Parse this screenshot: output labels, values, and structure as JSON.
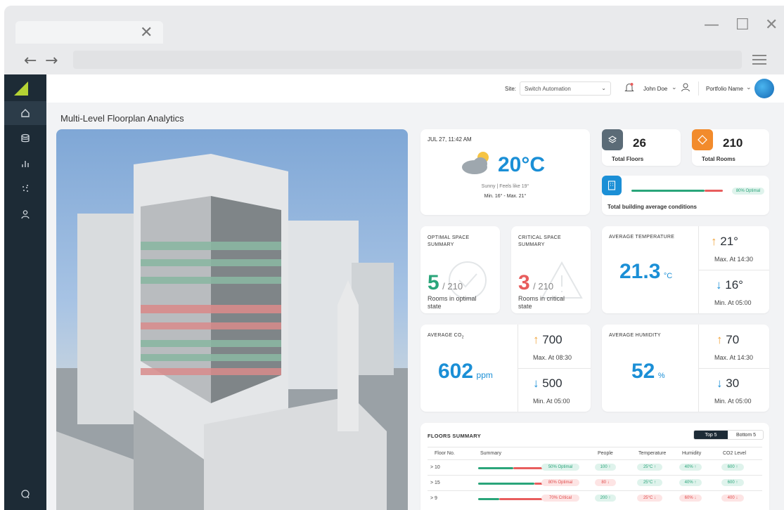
{
  "browser": {
    "close_glyph": "✕",
    "minimize_glyph": "—",
    "maximize_glyph": "☐",
    "window_close_glyph": "✕",
    "back_glyph": "←",
    "forward_glyph": "→"
  },
  "topbar": {
    "site_label": "Site:",
    "site_value": "Switch Automation",
    "user_name": "John Doe",
    "portfolio": "Portfolio Name"
  },
  "page_title": "Multi-Level Floorplan Analytics",
  "weather": {
    "datetime": "JUL 27, 11:42 AM",
    "temperature": "20°C",
    "desc": "Sunny | Feels like 19°",
    "range": "Min. 16° - Max. 21°"
  },
  "floors": {
    "value": "26",
    "label": "Total Floors"
  },
  "rooms": {
    "value": "210",
    "label": "Total Rooms"
  },
  "conditions": {
    "label": "Total building average conditions",
    "chip": "80% Optimal",
    "optimal_fraction": 0.8
  },
  "optimal": {
    "title": "OPTIMAL SPACE SUMMARY",
    "value": "5",
    "total": "/ 210",
    "desc": "Rooms in optimal state"
  },
  "critical": {
    "title": "CRITICAL SPACE SUMMARY",
    "value": "3",
    "total": "/ 210",
    "desc": "Rooms in critical state"
  },
  "avg_temp": {
    "title": "AVERAGE TEMPERATURE",
    "value": "21.3",
    "unit": "°C",
    "max": "21°",
    "max_label": "Max. At 14:30",
    "min": "16°",
    "min_label": "Min. At 05:00"
  },
  "avg_co2": {
    "title": "AVERAGE CO",
    "title_sub": "2",
    "value": "602",
    "unit": "ppm",
    "max": "700",
    "max_label": "Max. At 08:30",
    "min": "500",
    "min_label": "Min. At 05:00"
  },
  "avg_humidity": {
    "title": "AVERAGE HUMIDITY",
    "value": "52",
    "unit": "%",
    "max": "70",
    "max_label": "Max. At 14:30",
    "min": "30",
    "min_label": "Min. At 05:00"
  },
  "floors_summary": {
    "title": "FLOORS SUMMARY",
    "toggle": [
      "Top 5",
      "Bottom 5"
    ],
    "headers": [
      "Floor No.",
      "Summary",
      "People",
      "Temperature",
      "Humidity",
      "CO2 Level"
    ],
    "rows": [
      {
        "floor": "> 10",
        "summary": "50% Optimal",
        "people": "100 ↑",
        "temp": "25°C ↑",
        "humidity": "40% ↑",
        "co2": "600 ↑"
      },
      {
        "floor": "> 15",
        "summary": "80% Optimal",
        "people": "80 ↓",
        "temp": "25°C ↑",
        "humidity": "40% ↑",
        "co2": "600 ↑"
      },
      {
        "floor": "> 9",
        "summary": "70% Critical",
        "people": "200 ↑",
        "temp": "25°C ↓",
        "humidity": "60% ↓",
        "co2": "400 ↓"
      }
    ]
  },
  "colors": {
    "accent": "#1b8fd6",
    "optimal": "#2aa57a",
    "critical": "#e85d5d",
    "sidebar": "#1d2b36",
    "logo": "#b5d334",
    "up_arrow": "#f0a53d"
  }
}
